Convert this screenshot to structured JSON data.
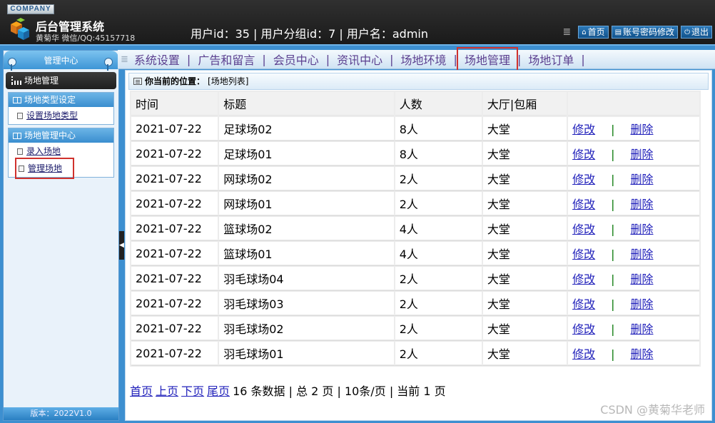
{
  "header": {
    "company": "COMPANY",
    "title": "后台管理系统",
    "subtitle": "黄菊华 微信/QQ:45157718",
    "user_info": "用户id：35 | 用户分组id：7 | 用户名：admin",
    "buttons": [
      {
        "label": "首页",
        "icon": "home-icon"
      },
      {
        "label": "账号密码修改",
        "icon": "form-icon"
      },
      {
        "label": "退出",
        "icon": "power-icon"
      }
    ]
  },
  "sidebar": {
    "heading": "管理中心",
    "current": "场地管理",
    "groups": [
      {
        "title": "场地类型设定",
        "items": [
          "设置场地类型"
        ]
      },
      {
        "title": "场地管理中心",
        "items": [
          "录入场地",
          "管理场地"
        ]
      }
    ],
    "version": "版本：2022V1.0"
  },
  "nav": {
    "items": [
      "系统设置",
      "广告和留言",
      "会员中心",
      "资讯中心",
      "场地环境",
      "场地管理",
      "场地订单"
    ],
    "active": "场地管理"
  },
  "breadcrumb": {
    "label": "你当前的位置：",
    "value": "[场地列表]"
  },
  "table": {
    "columns": [
      "时间",
      "标题",
      "人数",
      "大厅|包厢",
      ""
    ],
    "edit_label": "修改",
    "delete_label": "删除",
    "rows": [
      {
        "time": "2021-07-22",
        "title": "足球场02",
        "count": "8人",
        "hall": "大堂"
      },
      {
        "time": "2021-07-22",
        "title": "足球场01",
        "count": "8人",
        "hall": "大堂"
      },
      {
        "time": "2021-07-22",
        "title": "网球场02",
        "count": "2人",
        "hall": "大堂"
      },
      {
        "time": "2021-07-22",
        "title": "网球场01",
        "count": "2人",
        "hall": "大堂"
      },
      {
        "time": "2021-07-22",
        "title": "篮球场02",
        "count": "4人",
        "hall": "大堂"
      },
      {
        "time": "2021-07-22",
        "title": "篮球场01",
        "count": "4人",
        "hall": "大堂"
      },
      {
        "time": "2021-07-22",
        "title": "羽毛球场04",
        "count": "2人",
        "hall": "大堂"
      },
      {
        "time": "2021-07-22",
        "title": "羽毛球场03",
        "count": "2人",
        "hall": "大堂"
      },
      {
        "time": "2021-07-22",
        "title": "羽毛球场02",
        "count": "2人",
        "hall": "大堂"
      },
      {
        "time": "2021-07-22",
        "title": "羽毛球场01",
        "count": "2人",
        "hall": "大堂"
      }
    ]
  },
  "pager": {
    "first": "首页",
    "prev": "上页",
    "next": "下页",
    "last": "尾页",
    "summary": "16 条数据 | 总 2 页 | 10条/页 | 当前 1 页"
  },
  "watermark": "CSDN @黄菊华老师"
}
